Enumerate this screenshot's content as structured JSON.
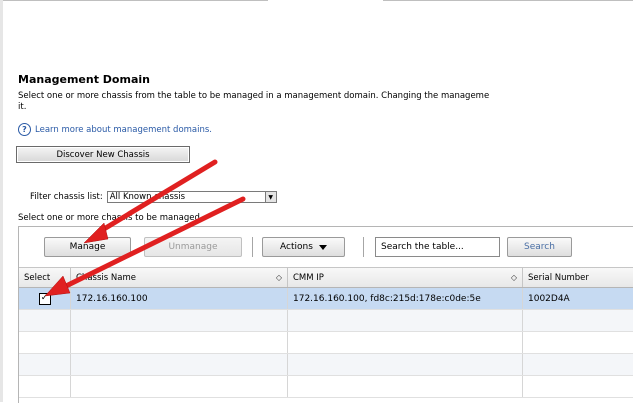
{
  "section": {
    "title": "Management Domain",
    "description": "Select one or more chassis from the table to be managed in a management domain. Changing the manageme",
    "description_line2": "it.",
    "learn_more_label": "Learn more about management domains."
  },
  "discover_button_label": "Discover New Chassis",
  "filter": {
    "label": "Filter chassis list:",
    "selected_value": "All Known chassis"
  },
  "select_instruction": "Select one or more chassis to be managed.",
  "toolbar": {
    "manage_label": "Manage",
    "unmanage_label": "Unmanage",
    "actions_label": "Actions",
    "search_placeholder": "Search the table...",
    "search_button_label": "Search"
  },
  "table": {
    "columns": [
      "Select",
      "Chassis Name",
      "CMM IP",
      "Serial Number"
    ],
    "rows": [
      {
        "checked": true,
        "chassis_name": "172.16.160.100",
        "cmm_ip": "172.16.160.100, fd8c:215d:178e:c0de:5e",
        "serial_number": "1002D4A"
      }
    ]
  },
  "icons": {
    "help": "help-circle-icon",
    "sort": "sort-icon",
    "dropdown": "chevron-down-icon"
  },
  "colors": {
    "link": "#2a5aa6",
    "selected_row": "#c6daf2",
    "annotation_arrow": "#e02020"
  }
}
